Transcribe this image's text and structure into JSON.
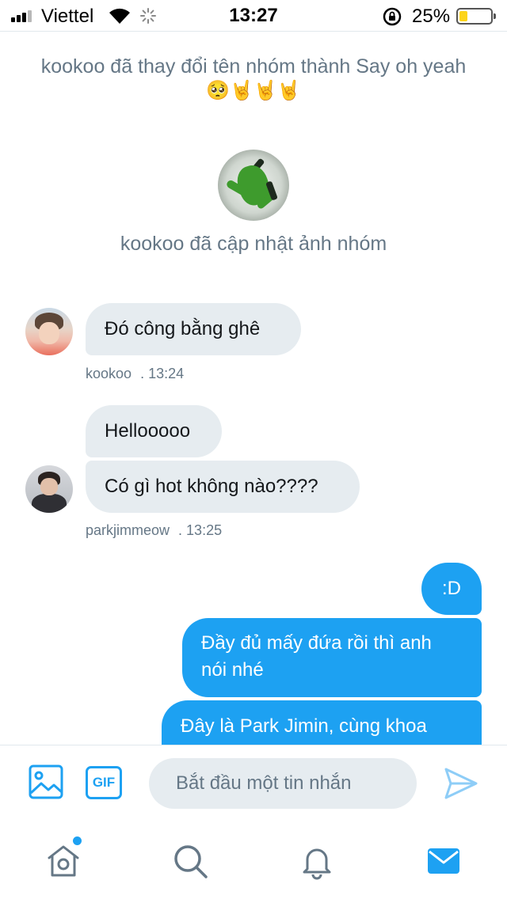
{
  "status_bar": {
    "carrier": "Viettel",
    "time": "13:27",
    "battery_percent": "25%",
    "battery_level": 0.25,
    "signal_bars": 3,
    "colors": {
      "battery": "#fdd41b"
    }
  },
  "conversation": {
    "system_messages": {
      "rename": "kookoo đã thay đổi tên nhóm thành Say oh yeah",
      "rename_emojis": "🥺🤘🤘🤘",
      "photo_update": "kookoo đã cập nhật ảnh nhóm"
    },
    "messages": [
      {
        "sender": "kookoo",
        "text": "Đó công bằng ghê",
        "direction": "incoming"
      },
      {
        "sender": "parkjimmeow",
        "text": "Hellooooo",
        "direction": "incoming"
      },
      {
        "sender": "parkjimmeow",
        "text": "Có gì hot không nào????",
        "direction": "incoming"
      },
      {
        "sender": "me",
        "text": ":D",
        "direction": "outgoing"
      },
      {
        "sender": "me",
        "text_line1": "Đầy đủ mấy đứa rồi thì anh",
        "text_line2": "nói nhé",
        "direction": "outgoing"
      },
      {
        "sender": "me",
        "text": "Đây là Park Jimin, cùng khoa",
        "direction": "outgoing"
      }
    ],
    "meta": [
      {
        "sender": "kookoo",
        "time": ". 13:24"
      },
      {
        "sender": "parkjimmeow",
        "time": ". 13:25"
      }
    ]
  },
  "composer": {
    "placeholder": "Bắt đầu một tin nhắn",
    "gif_label": "GIF",
    "media_icon": "image-icon",
    "send_icon": "send-icon"
  },
  "tab_bar": {
    "tabs": [
      {
        "name": "home",
        "icon": "home-icon",
        "has_notification_dot": true
      },
      {
        "name": "search",
        "icon": "search-icon"
      },
      {
        "name": "notifications",
        "icon": "bell-icon"
      },
      {
        "name": "messages",
        "icon": "mail-icon",
        "active": true
      }
    ]
  },
  "colors": {
    "accent": "#1da1f2",
    "incoming_bubble": "#e6ecf0",
    "secondary_text": "#657786",
    "icon_inactive": "#657786"
  }
}
